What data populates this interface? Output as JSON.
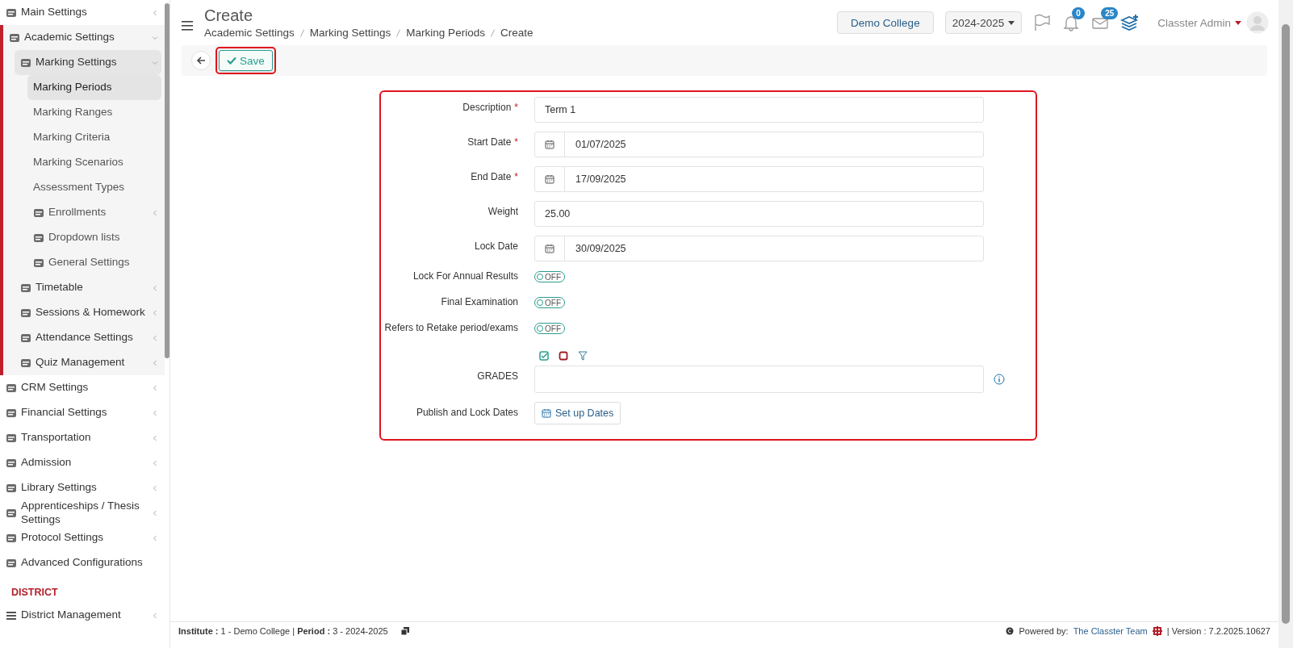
{
  "sidebar": {
    "items": [
      {
        "label": "Main Settings",
        "has_icon": true,
        "expanded": false
      },
      {
        "label": "Academic Settings",
        "has_icon": true,
        "expanded": true,
        "children": [
          {
            "label": "Marking Settings",
            "has_icon": true,
            "expanded": true,
            "children": [
              {
                "label": "Marking Periods",
                "selected": true
              },
              {
                "label": "Marking Ranges",
                "selected": false
              },
              {
                "label": "Marking Criteria",
                "selected": false
              },
              {
                "label": "Marking Scenarios",
                "selected": false
              },
              {
                "label": "Assessment Types",
                "selected": false
              },
              {
                "label": "Enrollments",
                "has_icon": true,
                "expanded": false
              },
              {
                "label": "Dropdown lists",
                "has_icon": true
              },
              {
                "label": "General Settings",
                "has_icon": true
              }
            ]
          },
          {
            "label": "Timetable",
            "has_icon": true,
            "expanded": false
          },
          {
            "label": "Sessions & Homework",
            "has_icon": true,
            "expanded": false
          },
          {
            "label": "Attendance Settings",
            "has_icon": true,
            "expanded": false
          },
          {
            "label": "Quiz Management",
            "has_icon": true,
            "expanded": false
          }
        ]
      },
      {
        "label": "CRM Settings",
        "has_icon": true,
        "expanded": false
      },
      {
        "label": "Financial Settings",
        "has_icon": true,
        "expanded": false
      },
      {
        "label": "Transportation",
        "has_icon": true,
        "expanded": false
      },
      {
        "label": "Admission",
        "has_icon": true,
        "expanded": false
      },
      {
        "label": "Library Settings",
        "has_icon": true,
        "expanded": false
      },
      {
        "label": "Apprenticeships / Thesis Settings",
        "has_icon": true,
        "expanded": false
      },
      {
        "label": "Protocol Settings",
        "has_icon": true,
        "expanded": false
      },
      {
        "label": "Advanced Configurations",
        "has_icon": true
      }
    ],
    "section": "DISTRICT",
    "section_items": [
      {
        "label": "District Management",
        "has_icon": true,
        "expanded": false
      }
    ]
  },
  "header": {
    "title": "Create",
    "breadcrumbs": [
      "Academic Settings",
      "Marking Settings",
      "Marking Periods",
      "Create"
    ],
    "school": "Demo College",
    "year": "2024-2025",
    "notifications": "0",
    "messages": "25",
    "user": "Classter Admin"
  },
  "toolbar": {
    "save": {
      "label": "Save",
      "highlighted": true
    }
  },
  "form": {
    "highlighted": true,
    "fields": [
      {
        "kind": "text",
        "label": "Description",
        "required_mark": "*",
        "value": "Term 1"
      },
      {
        "kind": "date",
        "label": "Start Date",
        "required_mark": "*",
        "value": "01/07/2025"
      },
      {
        "kind": "date",
        "label": "End Date",
        "required_mark": "*",
        "value": "17/09/2025"
      },
      {
        "kind": "text",
        "label": "Weight",
        "value": "25.00"
      },
      {
        "kind": "date",
        "label": "Lock Date",
        "value": "30/09/2025"
      },
      {
        "kind": "toggle",
        "label": "Lock For Annual Results",
        "on": false,
        "state": "OFF"
      },
      {
        "kind": "toggle",
        "label": "Final Examination",
        "on": false,
        "state": "OFF"
      },
      {
        "kind": "toggle",
        "label": "Refers to Retake period/exams",
        "on": false,
        "state": "OFF"
      },
      {
        "kind": "grades",
        "label": "GRADES"
      },
      {
        "kind": "button",
        "label": "Publish and Lock Dates",
        "button": "Set up Dates"
      }
    ]
  },
  "footer": {
    "info": "**Institute :** 1 - Demo College | **Period :** 3 - 2024-2025",
    "powered": "Powered by:",
    "team": "The Classter Team",
    "version": "| Version : 7.2.2025.10627"
  }
}
